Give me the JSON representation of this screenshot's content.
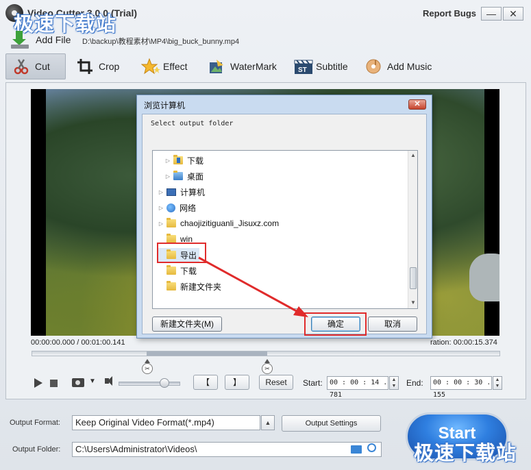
{
  "window": {
    "title": "Video Cutter 3.0.0 (Trial)",
    "report_bugs": "Report Bugs",
    "minimize": "—",
    "close": "✕"
  },
  "watermark": "极速下载站",
  "add_file": {
    "label": "Add File",
    "path": "D:\\backup\\教程素材\\MP4\\big_buck_bunny.mp4"
  },
  "toolbar": {
    "cut": "Cut",
    "crop": "Crop",
    "effect": "Effect",
    "watermark": "WaterMark",
    "subtitle": "Subtitle",
    "add_music": "Add Music"
  },
  "player": {
    "time_position": "00:00:00.000 / 00:01:00.141",
    "duration": "ration: 00:00:15.374",
    "reset": "Reset",
    "start_label": "Start:",
    "start_value": "00 : 00 : 14 . 781",
    "end_label": "End:",
    "end_value": "00 : 00 : 30 . 155",
    "mark_in": "【",
    "mark_out": "】"
  },
  "output": {
    "format_label": "Output Format:",
    "format_value": "Keep Original Video Format(*.mp4)",
    "settings_button": "Output Settings",
    "folder_label": "Output Folder:",
    "folder_value": "C:\\Users\\Administrator\\Videos\\",
    "start_button": "Start"
  },
  "dialog": {
    "title": "浏览计算机",
    "prompt": "Select output folder",
    "tree": [
      {
        "label": "下载",
        "icon": "download-folder-icon"
      },
      {
        "label": "桌面",
        "icon": "desktop-folder-icon"
      },
      {
        "label": "计算机",
        "icon": "computer-icon"
      },
      {
        "label": "网络",
        "icon": "network-icon"
      },
      {
        "label": "chaojizitiguanli_Jisuxz.com",
        "icon": "folder-icon"
      },
      {
        "label": "win",
        "icon": "folder-icon"
      },
      {
        "label": "导出",
        "icon": "folder-icon"
      },
      {
        "label": "下载",
        "icon": "folder-icon"
      },
      {
        "label": "新建文件夹",
        "icon": "folder-icon"
      }
    ],
    "new_folder_button": "新建文件夹(M)",
    "ok_button": "确定",
    "cancel_button": "取消"
  },
  "colors": {
    "highlight": "#e02b2b",
    "start_button": "#2f7fe0",
    "dialog_frame": "#c9dbf0"
  }
}
